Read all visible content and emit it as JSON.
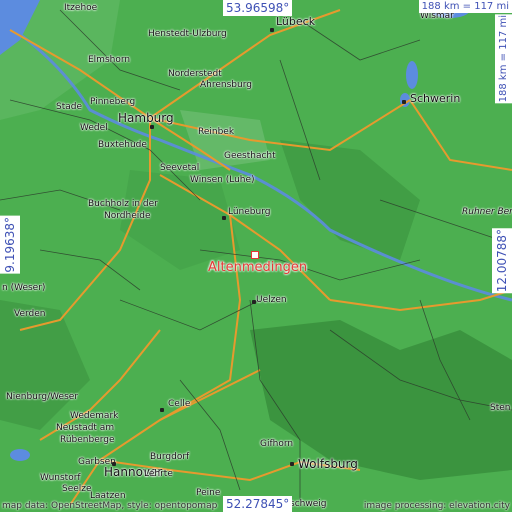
{
  "place_name": "Altenmedingen",
  "coordinates": {
    "top": "53.96598°",
    "bottom": "52.27845°",
    "left": "9.19638°",
    "right": "12.00788°"
  },
  "scale": {
    "horizontal": "188 km = 117 mi",
    "vertical": "188 km = 117 mi"
  },
  "attribution": {
    "left": "map data: OpenStreetMap, style: opentopomap",
    "right": "image processing: elevation.city"
  },
  "colors": {
    "terrain": "#4caf50",
    "highland": "#2e7d32",
    "water": "#5c8cdf",
    "road_major": "#e69a2e",
    "marker": "#e53935",
    "coordinate_text": "#3f51b5"
  },
  "cities": [
    {
      "name": "Itzehoe",
      "size": "small"
    },
    {
      "name": "Henstedt-Ulzburg",
      "size": "small"
    },
    {
      "name": "Lübeck",
      "size": "medium"
    },
    {
      "name": "Wismar",
      "size": "small"
    },
    {
      "name": "Elmshorn",
      "size": "small"
    },
    {
      "name": "Norderstedt",
      "size": "small"
    },
    {
      "name": "Ahrensburg",
      "size": "small"
    },
    {
      "name": "Stade",
      "size": "small"
    },
    {
      "name": "Pinneberg",
      "size": "small"
    },
    {
      "name": "Hamburg",
      "size": "big"
    },
    {
      "name": "Schwerin",
      "size": "medium"
    },
    {
      "name": "Wedel",
      "size": "small"
    },
    {
      "name": "Reinbek",
      "size": "small"
    },
    {
      "name": "Buxtehude",
      "size": "small"
    },
    {
      "name": "Geesthacht",
      "size": "small"
    },
    {
      "name": "Seevetal",
      "size": "small"
    },
    {
      "name": "Winsen (Luhe)",
      "size": "small"
    },
    {
      "name": "Buchholz in der",
      "size": "small"
    },
    {
      "name": "Nordheide",
      "size": "small"
    },
    {
      "name": "Lüneburg",
      "size": "small"
    },
    {
      "name": "Ruhner Berge",
      "size": "small",
      "italic": true
    },
    {
      "name": "Uelzen",
      "size": "small"
    },
    {
      "name": "Verden",
      "size": "small"
    },
    {
      "name": "n (Weser)",
      "size": "small"
    },
    {
      "name": "Nienburg/Weser",
      "size": "small"
    },
    {
      "name": "Celle",
      "size": "small"
    },
    {
      "name": "Wedemark",
      "size": "small"
    },
    {
      "name": "Neustadt am",
      "size": "small"
    },
    {
      "name": "Rübenberge",
      "size": "small"
    },
    {
      "name": "Gifhorn",
      "size": "small"
    },
    {
      "name": "Burgdorf",
      "size": "small"
    },
    {
      "name": "Garbsen",
      "size": "small"
    },
    {
      "name": "Hannover",
      "size": "big"
    },
    {
      "name": "Wunstorf",
      "size": "small"
    },
    {
      "name": "Lehrte",
      "size": "small"
    },
    {
      "name": "Seelze",
      "size": "small"
    },
    {
      "name": "Laatzen",
      "size": "small"
    },
    {
      "name": "Wolfsburg",
      "size": "big"
    },
    {
      "name": "Peine",
      "size": "small"
    },
    {
      "name": "schweig",
      "size": "small"
    },
    {
      "name": "Sten",
      "size": "small"
    }
  ]
}
